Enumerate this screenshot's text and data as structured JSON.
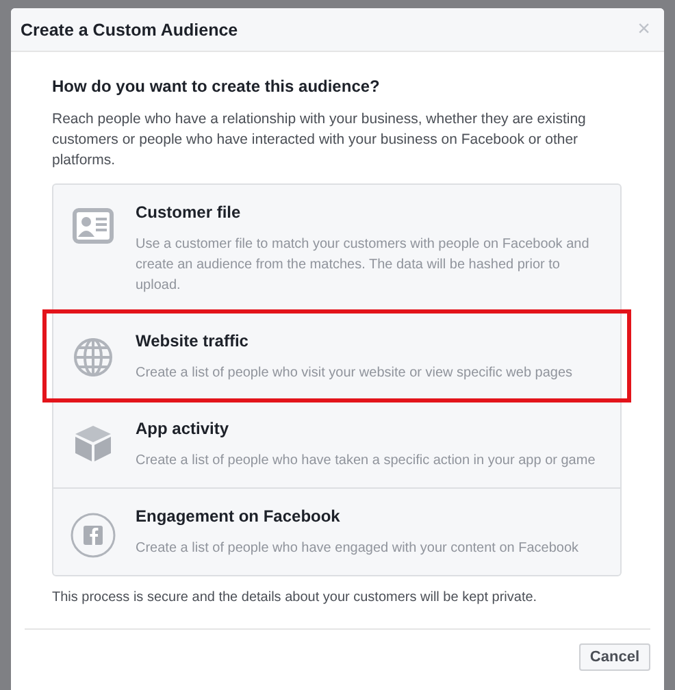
{
  "dialog": {
    "title": "Create a Custom Audience",
    "close": "×"
  },
  "heading": "How do you want to create this audience?",
  "intro": "Reach people who have a relationship with your business, whether they are existing customers or people who have interacted with your business on Facebook or other platforms.",
  "options": [
    {
      "kind": "contact-card",
      "title": "Customer file",
      "description": "Use a customer file to match your customers with people on Facebook and create an audience from the matches. The data will be hashed prior to upload.",
      "selected": false
    },
    {
      "kind": "globe",
      "title": "Website traffic",
      "description": "Create a list of people who visit your website or view specific web pages",
      "selected": true
    },
    {
      "kind": "cube",
      "title": "App activity",
      "description": "Create a list of people who have taken a specific action in your app or game",
      "selected": false
    },
    {
      "kind": "social",
      "title": "Engagement on Facebook",
      "description": "Create a list of people who have engaged with your content on Facebook",
      "selected": false
    }
  ],
  "note": "This process is secure and the details about your customers will be kept private.",
  "buttons": [
    "Cancel"
  ]
}
